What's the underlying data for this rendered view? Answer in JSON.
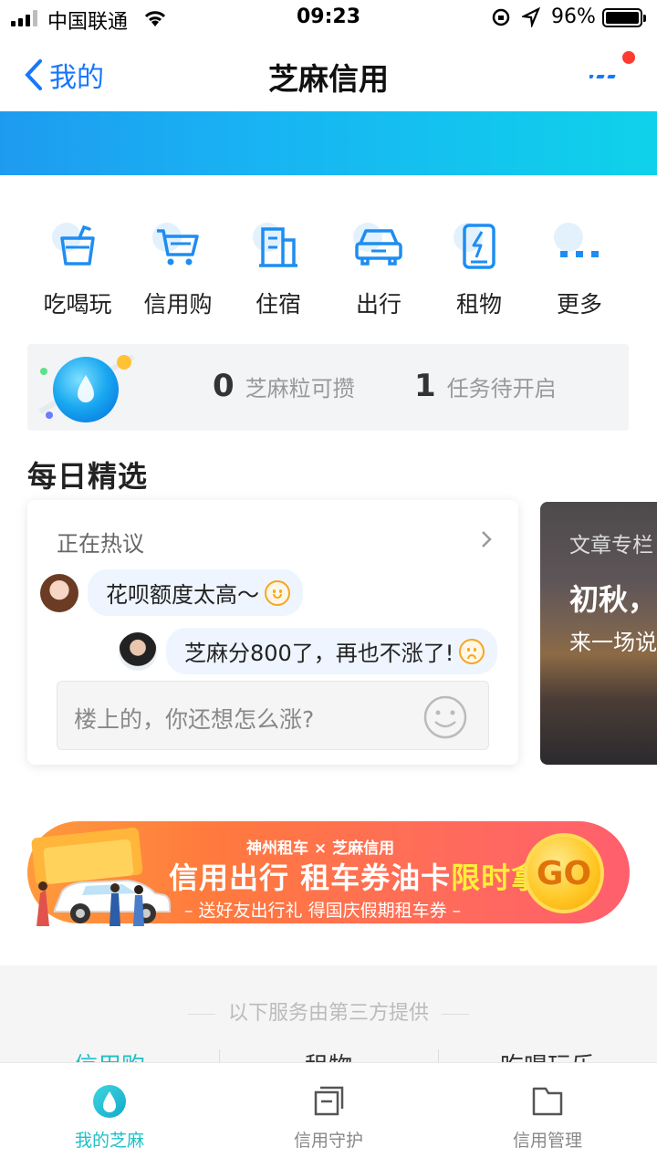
{
  "status_bar": {
    "carrier": "中国联通",
    "time": "09:23",
    "battery": "96%"
  },
  "nav": {
    "back_label": "我的",
    "title": "芝麻信用"
  },
  "colors": {
    "brand_blue": "#1677ff",
    "icon_blue": "#1e8df2",
    "active_teal": "#1ec0c8",
    "promo_highlight": "#ffee3a"
  },
  "quick_entries": [
    {
      "label": "吃喝玩",
      "icon": "cup-icon"
    },
    {
      "label": "信用购",
      "icon": "cart-icon"
    },
    {
      "label": "住宿",
      "icon": "building-icon"
    },
    {
      "label": "出行",
      "icon": "car-icon"
    },
    {
      "label": "租物",
      "icon": "power-bank-icon"
    },
    {
      "label": "更多",
      "icon": "more-dots-icon"
    }
  ],
  "points": {
    "grains_count": "0",
    "grains_label": "芝麻粒可攒",
    "tasks_count": "1",
    "tasks_label": "任务待开启"
  },
  "daily": {
    "title": "每日精选",
    "hot_card": {
      "header": "正在热议",
      "comment_1": "花呗额度太高～",
      "comment_2": "芝麻分800了，再也不涨了!",
      "input_placeholder": "楼上的，你还想怎么涨?"
    },
    "article_card": {
      "tag": "文章专栏",
      "title": "初秋，",
      "subtitle": "来一场说"
    }
  },
  "promo": {
    "brand": "神州租车 × 芝麻信用",
    "main_white": "信用出行 租车券油卡",
    "main_highlight": "限时拿",
    "sub": "– 送好友出行礼 得国庆假期租车券 –",
    "go": "GO"
  },
  "third_party": {
    "note": "以下服务由第三方提供",
    "tabs": [
      "信用购",
      "租物",
      "吃喝玩乐"
    ]
  },
  "tab_bar": [
    {
      "label": "我的芝麻",
      "active": true
    },
    {
      "label": "信用守护",
      "active": false
    },
    {
      "label": "信用管理",
      "active": false
    }
  ]
}
